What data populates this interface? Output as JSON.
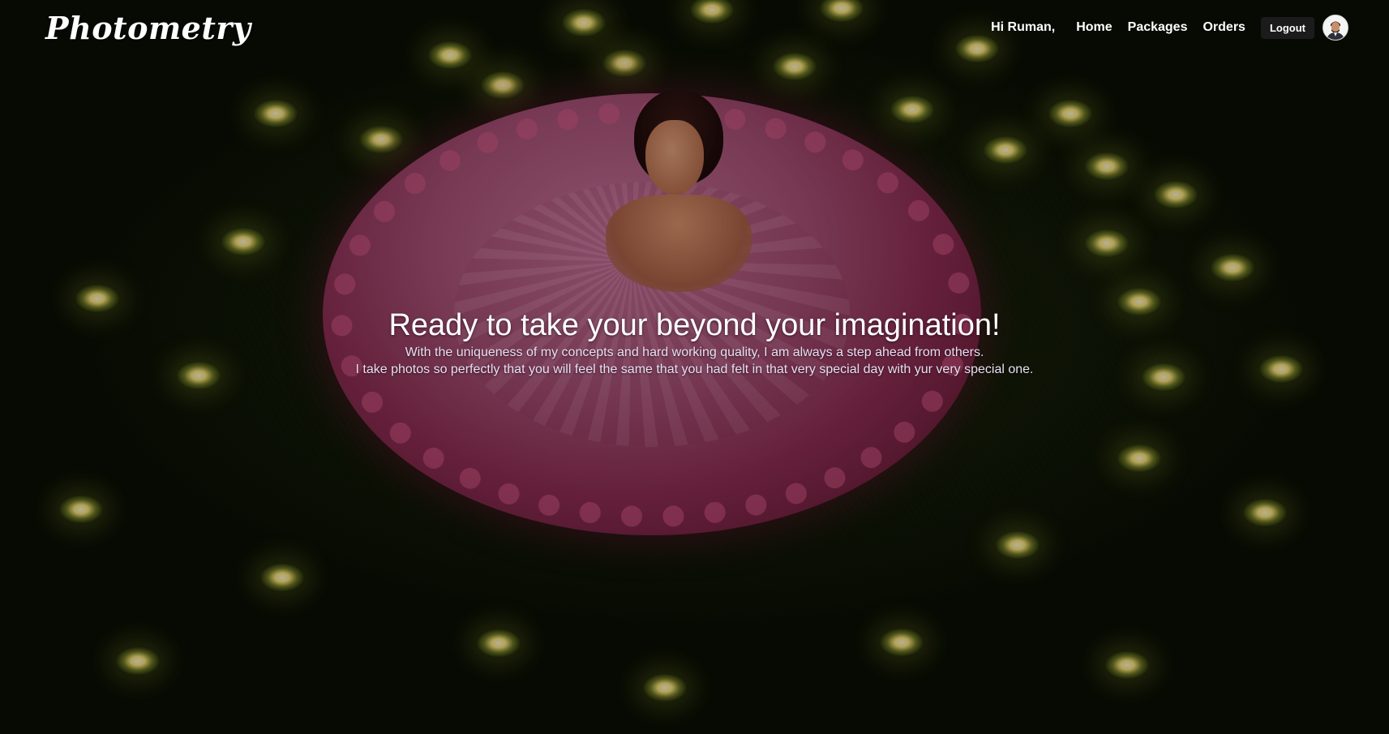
{
  "brand": {
    "logo_text": "Photometry"
  },
  "nav": {
    "greeting": "Hi Ruman,",
    "links": [
      "Home",
      "Packages",
      "Orders"
    ],
    "logout_label": "Logout"
  },
  "hero": {
    "headline": "Ready to take your beyond your imagination!",
    "line1": "With the uniqueness of my concepts and hard working quality, I am always a step ahead from others.",
    "line2": "I take photos so perfectly that you will feel the same that you had felt in that very special day with yur very special one."
  },
  "colors": {
    "nav_text": "#ffffff",
    "logout_bg": "#1b1b1b",
    "headline": "#ffffff",
    "subtext": "#e9dff2"
  },
  "icons": {
    "avatar": "user-avatar-icon"
  }
}
